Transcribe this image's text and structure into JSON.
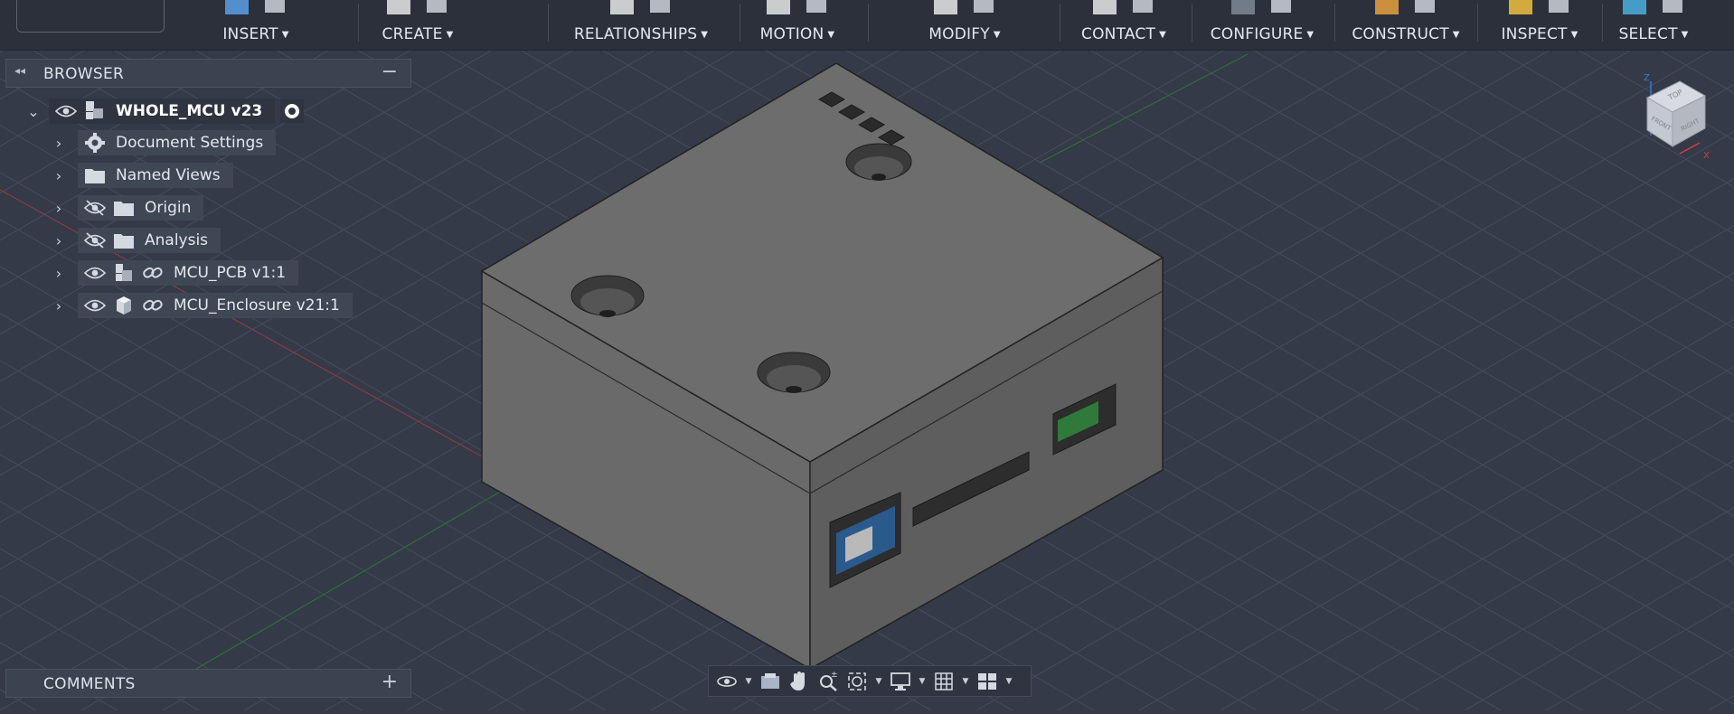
{
  "toolbar": {
    "groups": [
      {
        "label": "INSERT"
      },
      {
        "label": "CREATE"
      },
      {
        "label": "RELATIONSHIPS"
      },
      {
        "label": "MOTION"
      },
      {
        "label": "MODIFY"
      },
      {
        "label": "CONTACT"
      },
      {
        "label": "CONFIGURE"
      },
      {
        "label": "CONSTRUCT"
      },
      {
        "label": "INSPECT"
      },
      {
        "label": "SELECT"
      }
    ]
  },
  "browser": {
    "title": "BROWSER",
    "root": {
      "label": "WHOLE_MCU v23"
    },
    "items": [
      {
        "label": "Document Settings",
        "icon": "gear-icon"
      },
      {
        "label": "Named Views",
        "icon": "folder-icon"
      },
      {
        "label": "Origin",
        "icon": "folder-icon",
        "hidden": true
      },
      {
        "label": "Analysis",
        "icon": "folder-icon",
        "hidden": true
      },
      {
        "label": "MCU_PCB v1:1",
        "icon": "component-icon",
        "linked": true
      },
      {
        "label": "MCU_Enclosure v21:1",
        "icon": "body-icon",
        "linked": true
      }
    ]
  },
  "comments": {
    "title": "COMMENTS"
  },
  "viewcube": {
    "top": "TOP",
    "front": "FRONT",
    "right": "RIGHT"
  },
  "colors": {
    "background": "#343a47",
    "toolbar": "#2b303b",
    "grid": "#4a5162",
    "box": "#666666"
  }
}
